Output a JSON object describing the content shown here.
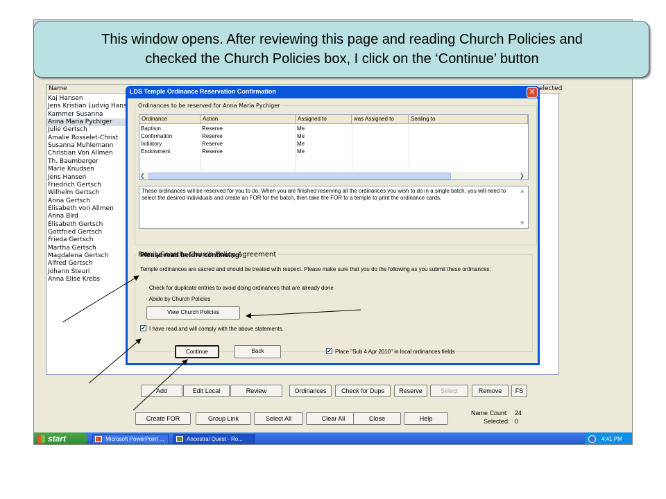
{
  "callout": {
    "line1": "This window opens.  After reviewing this page and reading Church Policies and",
    "line2": "checked the Church Policies box, I click on the ‘Continue’ button"
  },
  "name_list": {
    "header_name": "Name",
    "header_selected": "elected",
    "names": [
      "Kaj Hansen",
      "Jens Kristian Ludvig Hans...",
      "Kammer Susanna",
      "Anna Maria Pychiger",
      "Julie Gertsch",
      "Amalie Rosselet-Christ",
      "Susanna Muhlemann",
      "Christian Von Allmen",
      "Th. Baumberger",
      "Marie Knudsen",
      "Jens Hansen",
      "Friedrich Gertsch",
      "Wilhelm Gertsch",
      "Anna Gertsch",
      "Elisabeth von Allmen",
      "Anna Bird",
      "Elisabeth Gertsch",
      "Gottfried Gertsch",
      "Frieda Gertsch",
      "Martha Gertsch",
      "Magdalena Gertsch",
      "Alfred Gertsch",
      "Johann Steuri",
      "Anna Elise Krebs"
    ],
    "selected_index": 3
  },
  "dialog": {
    "title": "LDS Temple Ordinance Reservation Confirmation",
    "close_glyph": "✕",
    "ordinances_legend": "Ordinances to be reserved for Anna Maria Pychiger",
    "columns": [
      "Ordinance",
      "Action",
      "Assigned to",
      "was Assigned to",
      "Sealing to"
    ],
    "rows": [
      [
        "Baptism",
        "Reserve",
        "Me",
        "",
        ""
      ],
      [
        "Confirmation",
        "Reserve",
        "Me",
        "",
        ""
      ],
      [
        "Initiatory",
        "Reserve",
        "Me",
        "",
        ""
      ],
      [
        "Endowment",
        "Reserve",
        "Me",
        "",
        ""
      ]
    ],
    "memo": "These ordinances will be reserved for you to do. When you are finished reserving all the ordinances you wish to do in a single batch, you will need to select the desired individuals and create an FOR for the batch, then take the FOR to a temple to print the ordinance cards.",
    "policy_legend": "FamilySearch: Church Policy Agreement",
    "policy_heading": "Please read before continuing.",
    "policy_text": "Temple ordinances are sacred and should be treated with respect. Please make sure that you do the following as you submit these ordinances:",
    "bullet1": "· Check for duplicate entries to avoid doing ordinances that are already done",
    "bullet2": "· Abide by Church Policies",
    "view_policies": "View Church Policies",
    "agree_label": "I have read and will comply with the above statements.",
    "agree_checked": true,
    "continue": "Continue",
    "back": "Back",
    "place_label": "Place \"Sub 4 Apr 2010\" in local ordinances fields",
    "place_checked": true
  },
  "buttons_row1": [
    "Add",
    "Edit Local",
    "Review",
    "Ordinances",
    "Check for Dups",
    "Reserve",
    "Select",
    "Remove",
    "FS"
  ],
  "buttons_row2": [
    "Create FOR",
    "Group Link",
    "Select All",
    "Clear All",
    "Close",
    "Help"
  ],
  "counts": {
    "name_count_label": "Name Count:",
    "name_count": "24",
    "selected_label": "Selected:",
    "selected": "0"
  },
  "taskbar": {
    "start": "start",
    "task1": "Microsoft PowerPoint ...",
    "task2": "Ancestral Quest - Ro...",
    "time": "4:41 PM"
  },
  "colors": {
    "callout_bg": "#b9e0e2",
    "title_bar": "#0a56d8",
    "taskbar": "#2455c9",
    "start": "#2f8a2f"
  }
}
